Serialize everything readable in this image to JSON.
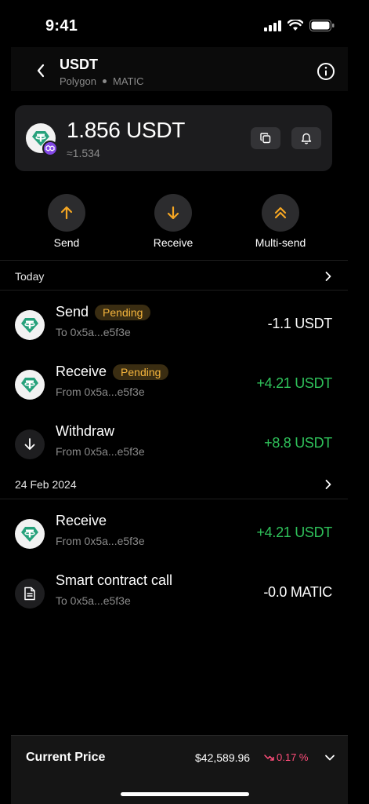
{
  "status_bar": {
    "time": "9:41"
  },
  "header": {
    "title": "USDT",
    "network": "Polygon",
    "native_token": "MATIC"
  },
  "balance": {
    "amount": "1.856 USDT",
    "fiat": "≈1.534"
  },
  "actions": [
    {
      "label": "Send",
      "icon": "arrow-up-icon"
    },
    {
      "label": "Receive",
      "icon": "arrow-down-icon"
    },
    {
      "label": "Multi-send",
      "icon": "double-chevron-up-icon"
    }
  ],
  "sections": [
    {
      "title": "Today",
      "transactions": [
        {
          "title": "Send",
          "badge": "Pending",
          "subtitle": "To 0x5a...e5f3e",
          "amount": "-1.1 USDT",
          "direction": "negative",
          "icon": "tether-icon"
        },
        {
          "title": "Receive",
          "badge": "Pending",
          "subtitle": "From 0x5a...e5f3e",
          "amount": "+4.21 USDT",
          "direction": "positive",
          "icon": "tether-icon"
        },
        {
          "title": "Withdraw",
          "badge": "",
          "subtitle": "From 0x5a...e5f3e",
          "amount": "+8.8 USDT",
          "direction": "positive",
          "icon": "arrow-down-icon"
        }
      ]
    },
    {
      "title": "24 Feb 2024",
      "transactions": [
        {
          "title": "Receive",
          "badge": "",
          "subtitle": "From 0x5a...e5f3e",
          "amount": "+4.21 USDT",
          "direction": "positive",
          "icon": "tether-icon"
        },
        {
          "title": "Smart contract call",
          "badge": "",
          "subtitle": "To 0x5a...e5f3e",
          "amount": "-0.0 MATIC",
          "direction": "negative",
          "icon": "document-icon"
        }
      ]
    }
  ],
  "price_bar": {
    "label": "Current Price",
    "value": "$42,589.96",
    "change": "0.17 %"
  },
  "colors": {
    "positive": "#2fc15a",
    "negative_change": "#ff4d7a",
    "accent": "#f5a623",
    "pending": "#f5b53d",
    "tether": "#26a17b",
    "polygon": "#8247e5"
  }
}
